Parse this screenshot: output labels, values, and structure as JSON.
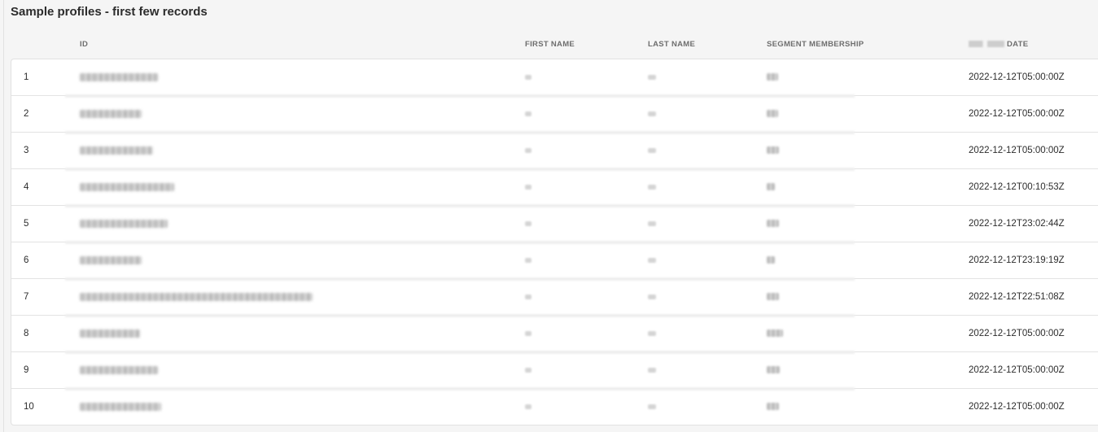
{
  "panel": {
    "title": "Sample profiles - first few records"
  },
  "table": {
    "columns": {
      "id": "ID",
      "first_name": "FIRST NAME",
      "last_name": "LAST NAME",
      "segment_membership": "SEGMENT MEMBERSHIP",
      "date": "DATE"
    },
    "rows": [
      {
        "num": "1",
        "date": "2022-12-12T05:00:00Z",
        "id_blur": 96,
        "seg_blur": 14
      },
      {
        "num": "2",
        "date": "2022-12-12T05:00:00Z",
        "id_blur": 76,
        "seg_blur": 14
      },
      {
        "num": "3",
        "date": "2022-12-12T05:00:00Z",
        "id_blur": 90,
        "seg_blur": 15
      },
      {
        "num": "4",
        "date": "2022-12-12T00:10:53Z",
        "id_blur": 116,
        "seg_blur": 10
      },
      {
        "num": "5",
        "date": "2022-12-12T23:02:44Z",
        "id_blur": 108,
        "seg_blur": 15
      },
      {
        "num": "6",
        "date": "2022-12-12T23:19:19Z",
        "id_blur": 76,
        "seg_blur": 10
      },
      {
        "num": "7",
        "date": "2022-12-12T22:51:08Z",
        "id_blur": 286,
        "seg_blur": 15
      },
      {
        "num": "8",
        "date": "2022-12-12T05:00:00Z",
        "id_blur": 74,
        "seg_blur": 20
      },
      {
        "num": "9",
        "date": "2022-12-12T05:00:00Z",
        "id_blur": 96,
        "seg_blur": 16
      },
      {
        "num": "10",
        "date": "2022-12-12T05:00:00Z",
        "id_blur": 100,
        "seg_blur": 15
      }
    ]
  }
}
